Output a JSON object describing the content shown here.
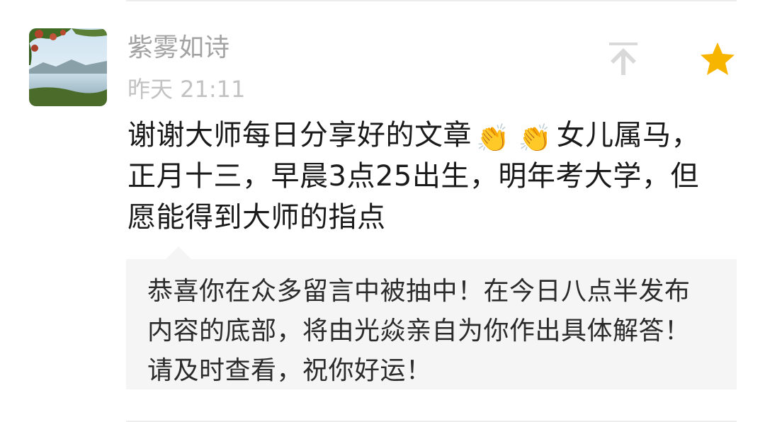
{
  "comment": {
    "author": "紫雾如诗",
    "time": "昨天 21:11",
    "text_part1": "谢谢大师每日分享好的文章",
    "emoji": "👏",
    "text_part2": "女儿属马，正月十三，早晨3点25出生，明年考大学，但愿能得到大师的指点",
    "avatar_icon": "landscape-avatar",
    "pin_icon": "pin-to-top-icon",
    "star_icon": "star-icon",
    "star_color": "#f7b500",
    "pin_color": "#d9d9d9"
  },
  "reply": {
    "text": "恭喜你在众多留言中被抽中！在今日八点半发布内容的底部，将由光焱亲自为你作出具体解答！请及时查看，祝你好运！"
  }
}
